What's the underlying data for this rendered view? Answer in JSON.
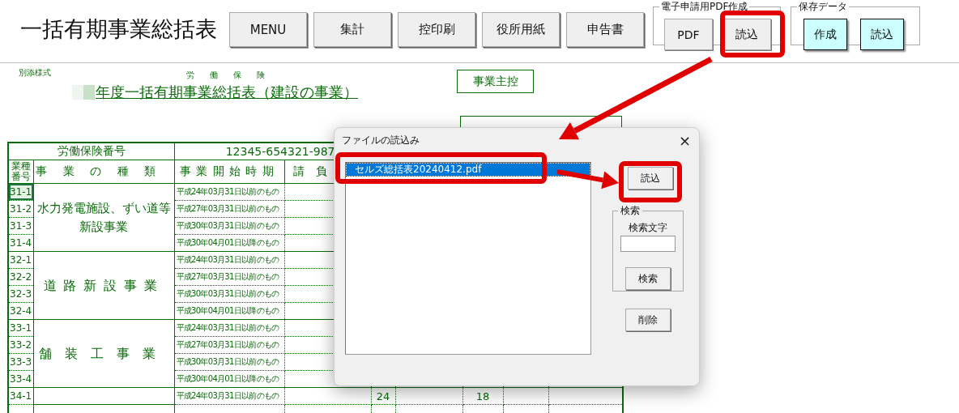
{
  "window": {
    "title": "一括有期事業総括表"
  },
  "toolbar": {
    "buttons": [
      "MENU",
      "集計",
      "控印刷",
      "役所用紙",
      "申告書"
    ],
    "groups": [
      {
        "label": "電子申請用PDF作成",
        "buttons": [
          {
            "label": "PDF",
            "kind": "plain"
          },
          {
            "label": "読込",
            "kind": "plain"
          }
        ]
      },
      {
        "label": "保存データ",
        "buttons": [
          {
            "label": "作成",
            "kind": "accent"
          },
          {
            "label": "読込",
            "kind": "accent"
          }
        ]
      }
    ]
  },
  "sheet": {
    "form_label": "別添様式",
    "ruby": "労働保険",
    "title": "年度一括有期事業総括表（建設の事業）",
    "copy_label": "事業主控",
    "table": {
      "insurance_label": "労働保険番号",
      "insurance_number": "12345-654321-987",
      "columns": [
        "業種番号",
        "事業の種類",
        "事業開始時期",
        "請負"
      ],
      "groups": [
        {
          "name": "水力発電施設、ずい道等新設事業",
          "rows": [
            {
              "code": "31-1",
              "period": "平成24年03月31日以前のもの",
              "selected": true
            },
            {
              "code": "31-2",
              "period": "平成27年03月31日以前のもの",
              "selected": false
            },
            {
              "code": "31-3",
              "period": "平成30年03月31日以前のもの",
              "selected": false
            },
            {
              "code": "31-4",
              "period": "平成30年04月01日以降のもの",
              "selected": false
            }
          ]
        },
        {
          "name": "道路新設事業",
          "rows": [
            {
              "code": "32-1",
              "period": "平成24年03月31日以前のもの",
              "selected": false
            },
            {
              "code": "32-2",
              "period": "平成27年03月31日以前のもの",
              "selected": false
            },
            {
              "code": "32-3",
              "period": "平成30年03月31日以前のもの",
              "selected": false
            },
            {
              "code": "32-4",
              "period": "平成30年04月01日以降のもの",
              "selected": false
            }
          ]
        },
        {
          "name": "舗装工事業",
          "rows": [
            {
              "code": "33-1",
              "period": "平成24年03月31日以前のもの",
              "selected": false
            },
            {
              "code": "33-2",
              "period": "平成27年03月31日以前のもの",
              "selected": false
            },
            {
              "code": "33-3",
              "period": "平成30年03月31日以前のもの",
              "selected": false
            },
            {
              "code": "33-4",
              "period": "平成30年04月01日以降のもの",
              "selected": false
            }
          ]
        },
        {
          "rows": [
            {
              "code": "34-1",
              "period": "平成24年03月31日以前のもの",
              "selected": false,
              "column_5": "24",
              "column_7": "18"
            }
          ]
        }
      ]
    }
  },
  "dialog": {
    "title": "ファイルの読込み",
    "close": "×",
    "files": [
      {
        "label": "セルズ総括表20240412.pdf",
        "selected": true
      }
    ],
    "load_button": "読込",
    "search": {
      "label": "検索",
      "field_label": "検索文字",
      "button": "検索"
    },
    "delete_button": "削除"
  },
  "annotations": [
    {
      "kind": "box"
    },
    {
      "kind": "arrow"
    },
    {
      "kind": "box"
    },
    {
      "kind": "arrow"
    },
    {
      "kind": "box"
    }
  ]
}
